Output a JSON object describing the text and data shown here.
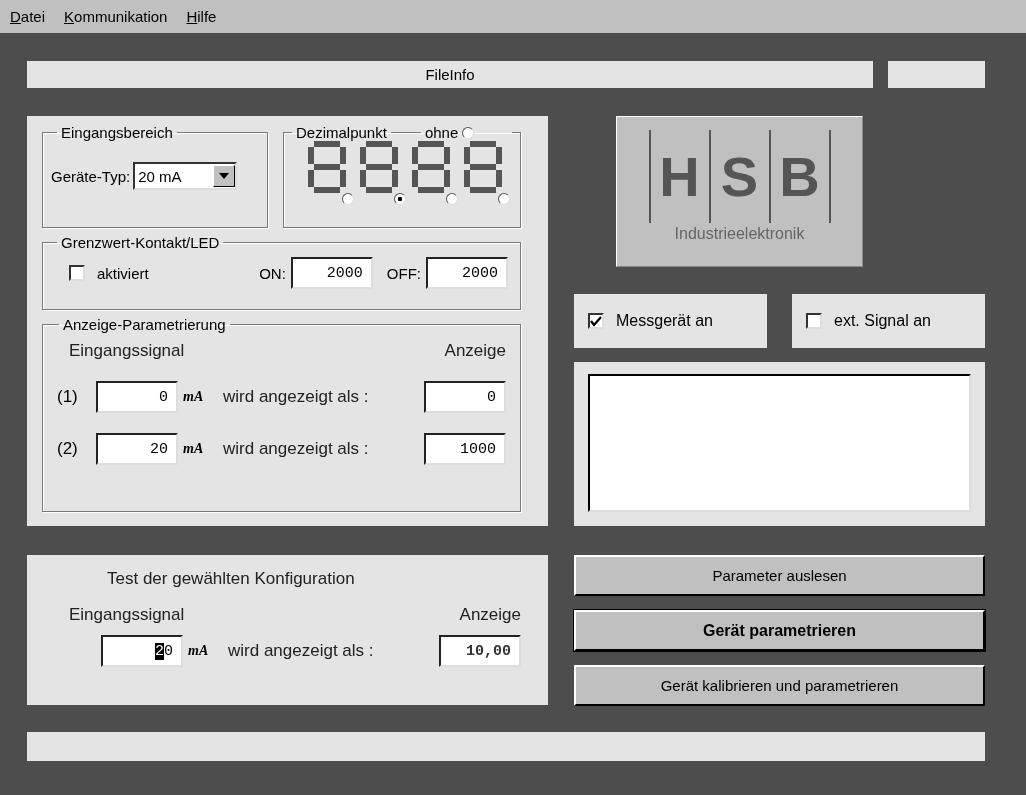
{
  "menu": [
    {
      "label": "Datei"
    },
    {
      "label": "Kommunikation"
    },
    {
      "label": "Hilfe"
    }
  ],
  "file_info": {
    "label": "FileInfo"
  },
  "eingangsbereich": {
    "title": "Eingangsbereich",
    "label": "Geräte-Typ:",
    "value": "20 mA"
  },
  "dezimalpunkt": {
    "title": "Dezimalpunkt",
    "none_label": "ohne",
    "none_selected": false,
    "positions": [
      {
        "selected": false
      },
      {
        "selected": true
      },
      {
        "selected": false
      },
      {
        "selected": false
      }
    ]
  },
  "grenzwert": {
    "title": "Grenzwert-Kontakt/LED",
    "checkbox": {
      "label": "aktiviert",
      "checked": false
    },
    "on_label": "ON:",
    "on_value": "2000",
    "off_label": "OFF:",
    "off_value": "2000"
  },
  "anzeige_parametrierung": {
    "title": "Anzeige-Parametrierung",
    "col_input": "Eingangssignal",
    "col_display": "Anzeige",
    "rows": [
      {
        "index": "(1)",
        "input": "0",
        "unit": "mA",
        "text": "wird angezeigt als :",
        "display": "0"
      },
      {
        "index": "(2)",
        "input": "20",
        "unit": "mA",
        "text": "wird angezeigt als :",
        "display": "1000"
      }
    ]
  },
  "test": {
    "title": "Test der gewählten Konfiguration",
    "col_input": "Eingangssignal",
    "col_display": "Anzeige",
    "input_selected": "2",
    "input_rest": "0",
    "unit": "mA",
    "text": "wird angezeigt als :",
    "display": "10,00"
  },
  "logo": {
    "letters": [
      "H",
      "S",
      "B"
    ],
    "tagline": "Industrieelektronik"
  },
  "checkboxes": [
    {
      "label": "Messgerät an",
      "checked": true
    },
    {
      "label": "ext. Signal an",
      "checked": false
    }
  ],
  "buttons": [
    {
      "label": "Parameter auslesen",
      "default": false
    },
    {
      "label": "Gerät parametrieren",
      "default": true
    },
    {
      "label": "Gerät kalibrieren und parametrieren",
      "default": false
    }
  ]
}
